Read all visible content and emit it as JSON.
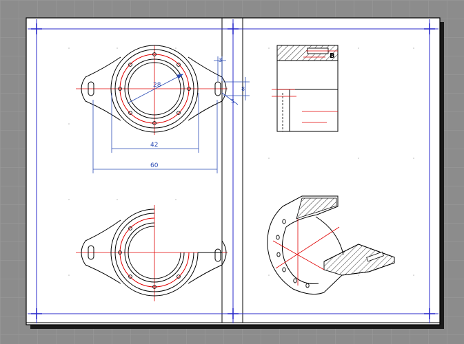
{
  "colors": {
    "workspace": "#8c8c8c",
    "grid": "#9b9b9b",
    "paper": "#ffffff",
    "shadow": "#1a1a1a",
    "frame": "#000000",
    "margin": "#2a2acb",
    "geometry": "#000000",
    "centerline": "#e00000",
    "dimension": "#2a4bb5",
    "hatch": "#000000"
  },
  "dimensions": {
    "d42": "42",
    "d60": "60",
    "d28": "28",
    "d3": "3",
    "d5": "5",
    "d8": "8"
  },
  "section_label": "B",
  "icons": [
    "crosshair-marker-icon"
  ]
}
